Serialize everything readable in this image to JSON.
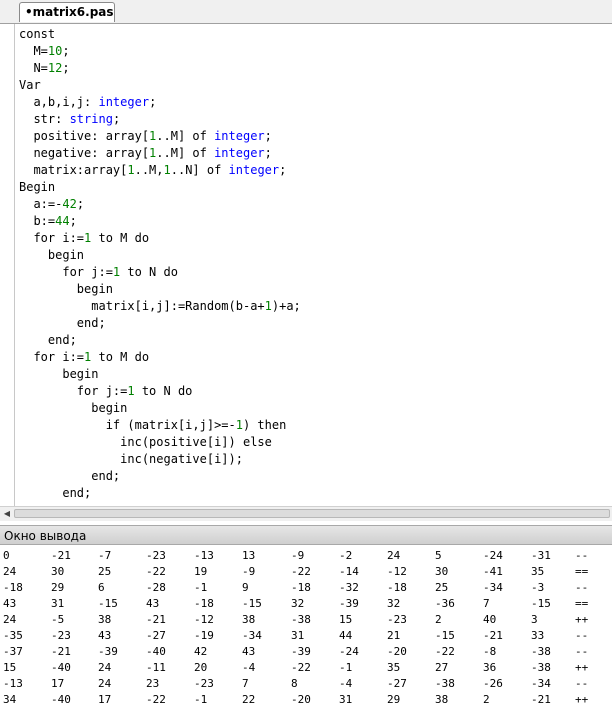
{
  "tab": {
    "label": "•matrix6.pas"
  },
  "code_lines": [
    [
      [
        "",
        "const"
      ]
    ],
    [
      [
        "",
        "  M="
      ],
      [
        "num",
        "10"
      ],
      [
        "",
        ";"
      ]
    ],
    [
      [
        "",
        "  N="
      ],
      [
        "num",
        "12"
      ],
      [
        "",
        ";"
      ]
    ],
    [
      [
        "",
        "Var"
      ]
    ],
    [
      [
        "",
        "  a,b,i,j: "
      ],
      [
        "kw",
        "integer"
      ],
      [
        "",
        ";"
      ]
    ],
    [
      [
        "",
        "  str: "
      ],
      [
        "kw",
        "string"
      ],
      [
        "",
        ";"
      ]
    ],
    [
      [
        "",
        "  positive: array["
      ],
      [
        "num",
        "1"
      ],
      [
        "",
        "..M] of "
      ],
      [
        "kw",
        "integer"
      ],
      [
        "",
        ";"
      ]
    ],
    [
      [
        "",
        "  negative: array["
      ],
      [
        "num",
        "1"
      ],
      [
        "",
        "..M] of "
      ],
      [
        "kw",
        "integer"
      ],
      [
        "",
        ";"
      ]
    ],
    [
      [
        "",
        "  matrix:array["
      ],
      [
        "num",
        "1"
      ],
      [
        "",
        "..M,"
      ],
      [
        "num",
        "1"
      ],
      [
        "",
        "..N] of "
      ],
      [
        "kw",
        "integer"
      ],
      [
        "",
        ";"
      ]
    ],
    [
      [
        "",
        "Begin"
      ]
    ],
    [
      [
        "",
        "  a:=-"
      ],
      [
        "num",
        "42"
      ],
      [
        "",
        ";"
      ]
    ],
    [
      [
        "",
        "  b:="
      ],
      [
        "num",
        "44"
      ],
      [
        "",
        ";"
      ]
    ],
    [
      [
        "",
        "  for i:="
      ],
      [
        "num",
        "1"
      ],
      [
        "",
        " to M do"
      ]
    ],
    [
      [
        "",
        "    begin"
      ]
    ],
    [
      [
        "",
        "      for j:="
      ],
      [
        "num",
        "1"
      ],
      [
        "",
        " to N do"
      ]
    ],
    [
      [
        "",
        "        begin"
      ]
    ],
    [
      [
        "",
        "          matrix[i,j]:=Random(b-a+"
      ],
      [
        "num",
        "1"
      ],
      [
        "",
        ")+a;"
      ]
    ],
    [
      [
        "",
        "        end;"
      ]
    ],
    [
      [
        "",
        "    end;"
      ]
    ],
    [
      [
        "",
        "  for i:="
      ],
      [
        "num",
        "1"
      ],
      [
        "",
        " to M do"
      ]
    ],
    [
      [
        "",
        "      begin"
      ]
    ],
    [
      [
        "",
        "        for j:="
      ],
      [
        "num",
        "1"
      ],
      [
        "",
        " to N do"
      ]
    ],
    [
      [
        "",
        "          begin"
      ]
    ],
    [
      [
        "",
        "            if (matrix[i,j]>=-"
      ],
      [
        "num",
        "1"
      ],
      [
        "",
        ") then"
      ]
    ],
    [
      [
        "",
        "              inc(positive[i]) else"
      ]
    ],
    [
      [
        "",
        "              inc(negative[i]);"
      ]
    ],
    [
      [
        "",
        "          end;"
      ]
    ],
    [
      [
        "",
        "      end;"
      ]
    ]
  ],
  "output_panel": {
    "title": "Окно вывода",
    "rows": [
      [
        "0",
        "-21",
        "-7",
        "-23",
        "-13",
        "13",
        "-9",
        "-2",
        "24",
        "5",
        "-24",
        "-31",
        "--"
      ],
      [
        "24",
        "30",
        "25",
        "-22",
        "19",
        "-9",
        "-22",
        "-14",
        "-12",
        "30",
        "-41",
        "35",
        "=="
      ],
      [
        "-18",
        "29",
        "6",
        "-28",
        "-1",
        "9",
        "-18",
        "-32",
        "-18",
        "25",
        "-34",
        "-3",
        "--"
      ],
      [
        "43",
        "31",
        "-15",
        "43",
        "-18",
        "-15",
        "32",
        "-39",
        "32",
        "-36",
        "7",
        "-15",
        "=="
      ],
      [
        "24",
        "-5",
        "38",
        "-21",
        "-12",
        "38",
        "-38",
        "15",
        "-23",
        "2",
        "40",
        "3",
        "++"
      ],
      [
        "-35",
        "-23",
        "43",
        "-27",
        "-19",
        "-34",
        "31",
        "44",
        "21",
        "-15",
        "-21",
        "33",
        "--"
      ],
      [
        "-37",
        "-21",
        "-39",
        "-40",
        "42",
        "43",
        "-39",
        "-24",
        "-20",
        "-22",
        "-8",
        "-38",
        "--"
      ],
      [
        "15",
        "-40",
        "24",
        "-11",
        "20",
        "-4",
        "-22",
        "-1",
        "35",
        "27",
        "36",
        "-38",
        "++"
      ],
      [
        "-13",
        "17",
        "24",
        "23",
        "-23",
        "7",
        "8",
        "-4",
        "-27",
        "-38",
        "-26",
        "-34",
        "--"
      ],
      [
        "34",
        "-40",
        "17",
        "-22",
        "-1",
        "22",
        "-20",
        "31",
        "29",
        "38",
        "2",
        "-21",
        "++"
      ]
    ]
  },
  "colors": {
    "keyword": "#0000ff",
    "number": "#008000"
  }
}
